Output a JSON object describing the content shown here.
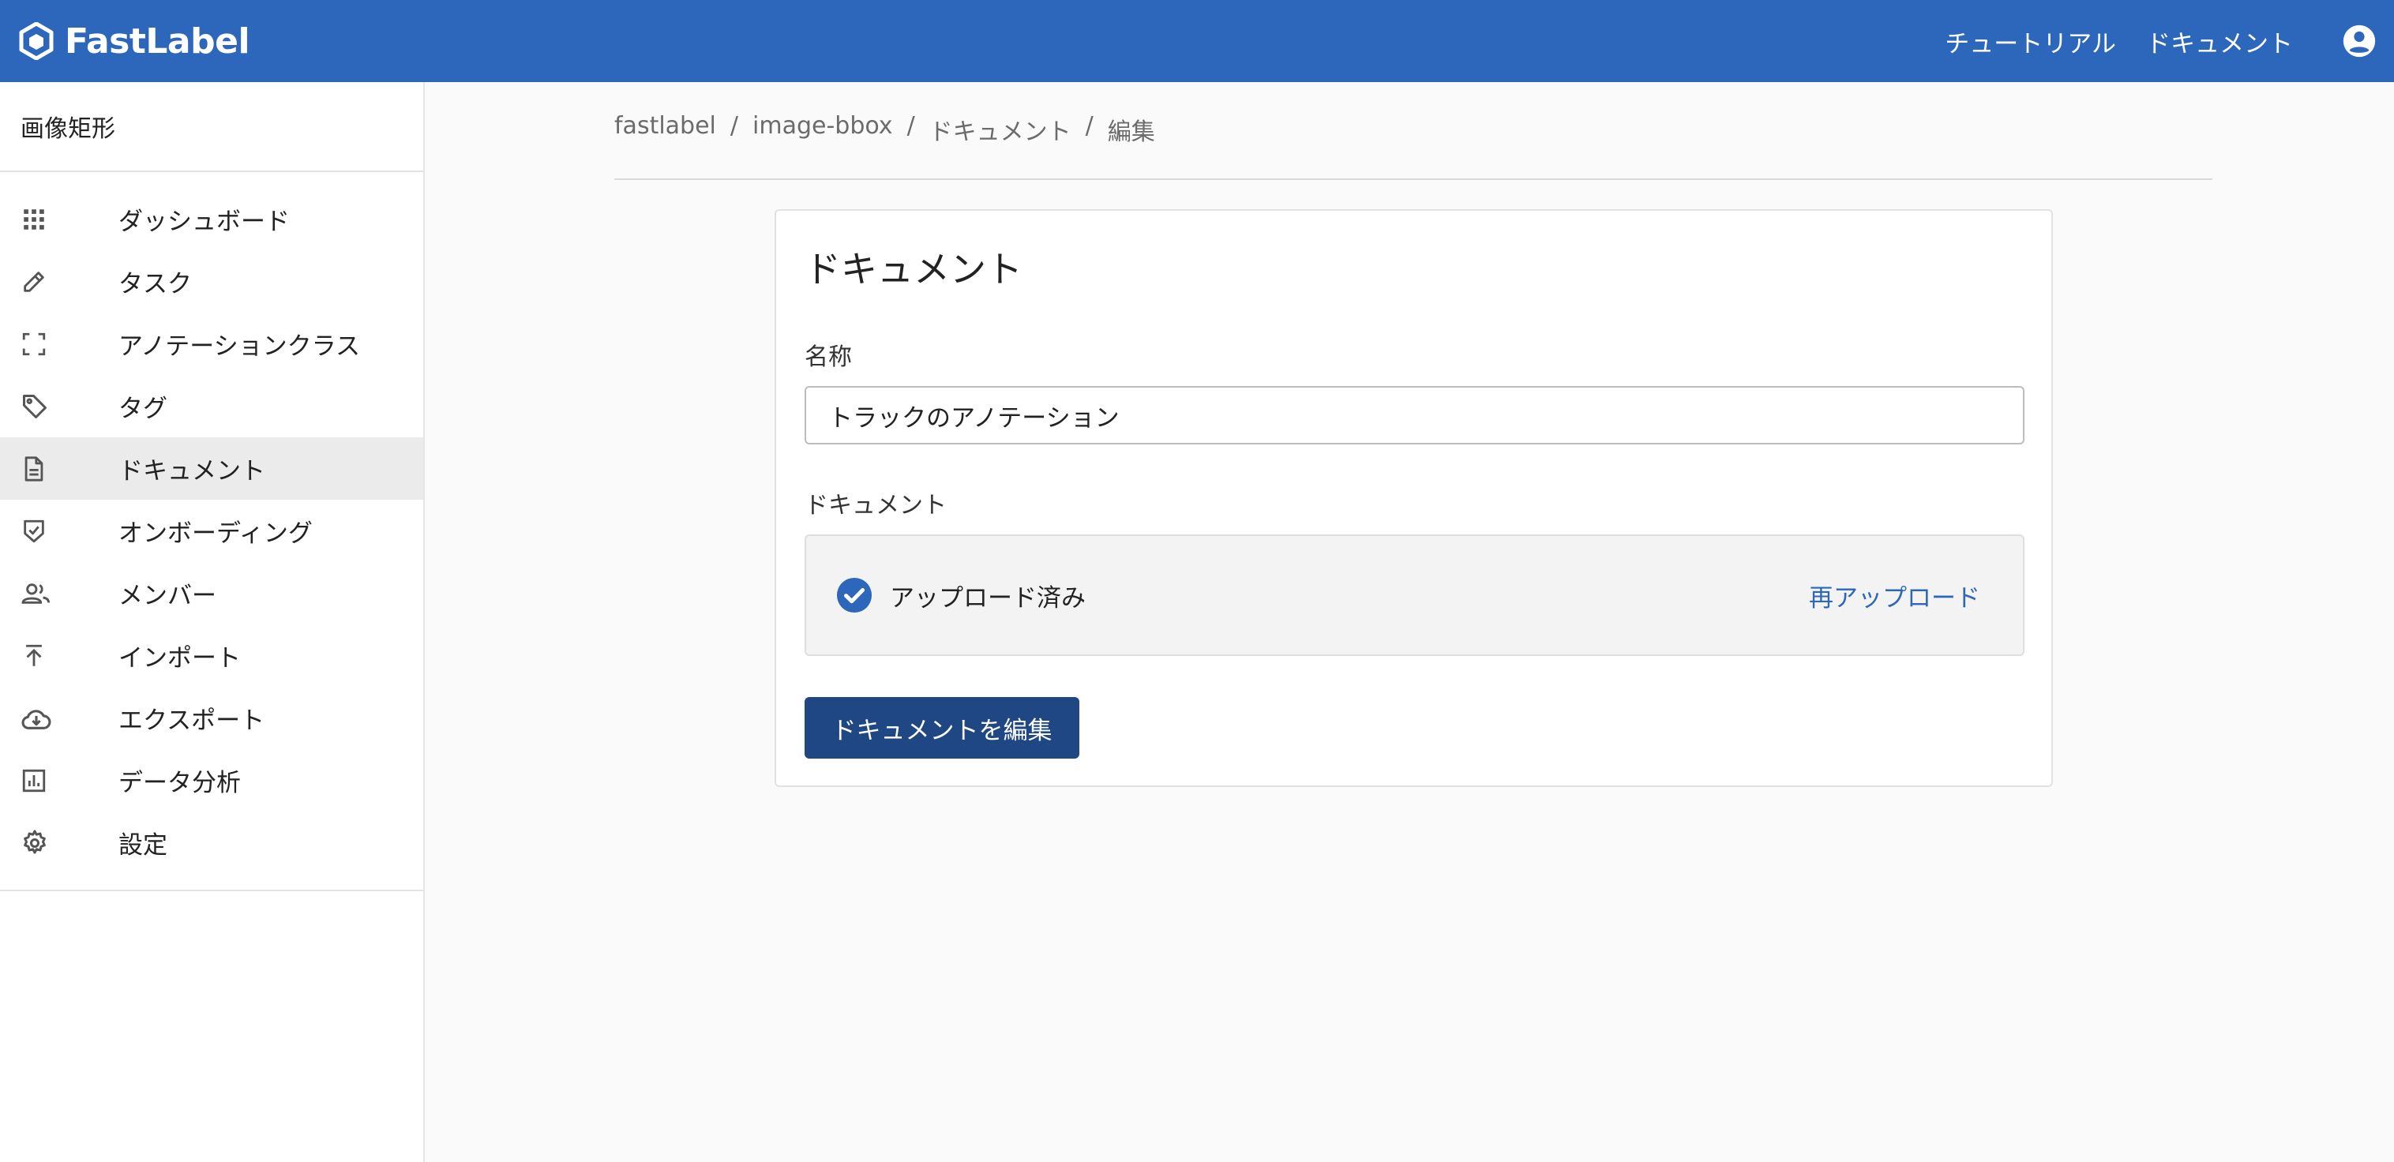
{
  "header": {
    "brand": "FastLabel",
    "nav": [
      "チュートリアル",
      "ドキュメント"
    ],
    "brand_color": "#2d67bc"
  },
  "sidebar": {
    "project_title": "画像矩形",
    "items": [
      {
        "label": "ダッシュボード",
        "icon": "grid-icon"
      },
      {
        "label": "タスク",
        "icon": "pencil-icon"
      },
      {
        "label": "アノテーションクラス",
        "icon": "bounding-box-icon"
      },
      {
        "label": "タグ",
        "icon": "tag-icon"
      },
      {
        "label": "ドキュメント",
        "icon": "document-icon",
        "active": true
      },
      {
        "label": "オンボーディング",
        "icon": "shield-check-icon"
      },
      {
        "label": "メンバー",
        "icon": "people-icon"
      },
      {
        "label": "インポート",
        "icon": "import-icon"
      },
      {
        "label": "エクスポート",
        "icon": "cloud-download-icon"
      },
      {
        "label": "データ分析",
        "icon": "bar-chart-icon"
      },
      {
        "label": "設定",
        "icon": "gear-icon"
      }
    ]
  },
  "breadcrumb": [
    "fastlabel",
    "image-bbox",
    "ドキュメント",
    "編集"
  ],
  "card": {
    "title": "ドキュメント",
    "name_label": "名称",
    "name_value": "トラックのアノテーション",
    "document_label": "ドキュメント",
    "upload_status": "アップロード済み",
    "reupload_label": "再アップロード",
    "edit_button": "ドキュメントを編集",
    "button_color": "#1e4784"
  }
}
